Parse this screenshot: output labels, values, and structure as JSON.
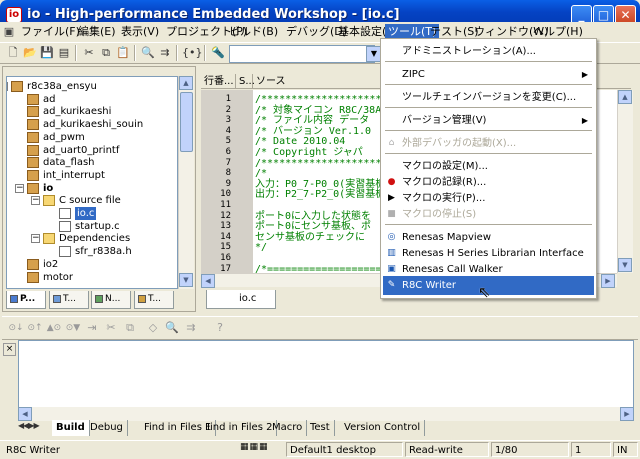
{
  "window": {
    "title": "io - High-performance Embedded Workshop - [io.c]",
    "minimize": "_",
    "maximize": "□",
    "close": "✕"
  },
  "menubar": {
    "items": [
      "ファイル(F)",
      "編集(E)",
      "表示(V)",
      "プロジェクト(P)",
      "ビルド(B)",
      "デバッグ(D)",
      "基本設定(U)",
      "ツール(T)",
      "テスト(S)",
      "ウィンドウ(W)",
      "ヘルプ(H)"
    ],
    "active_index": 7
  },
  "workspace": {
    "tree": [
      {
        "label": "r8c38a_ensyu",
        "depth": 0,
        "type": "project",
        "expander": "−"
      },
      {
        "label": "ad",
        "depth": 1,
        "type": "project"
      },
      {
        "label": "ad_kurikaeshi",
        "depth": 1,
        "type": "project"
      },
      {
        "label": "ad_kurikaeshi_souin",
        "depth": 1,
        "type": "project"
      },
      {
        "label": "ad_pwm",
        "depth": 1,
        "type": "project"
      },
      {
        "label": "ad_uart0_printf",
        "depth": 1,
        "type": "project"
      },
      {
        "label": "data_flash",
        "depth": 1,
        "type": "project"
      },
      {
        "label": "int_interrupt",
        "depth": 1,
        "type": "project"
      },
      {
        "label": "io",
        "depth": 1,
        "type": "project",
        "expander": "−",
        "bold": true
      },
      {
        "label": "C source file",
        "depth": 2,
        "type": "folder",
        "expander": "−"
      },
      {
        "label": "io.c",
        "depth": 3,
        "type": "file",
        "selected": true
      },
      {
        "label": "startup.c",
        "depth": 3,
        "type": "file"
      },
      {
        "label": "Dependencies",
        "depth": 2,
        "type": "folder",
        "expander": "−"
      },
      {
        "label": "sfr_r838a.h",
        "depth": 3,
        "type": "file"
      },
      {
        "label": "io2",
        "depth": 1,
        "type": "project"
      },
      {
        "label": "motor",
        "depth": 1,
        "type": "project"
      }
    ],
    "tabs": [
      "P...",
      "T...",
      "N...",
      "T..."
    ]
  },
  "editor": {
    "header": {
      "line": "行番...",
      "s": "S...",
      "source": "ソース"
    },
    "line_numbers": [
      "1",
      "2",
      "3",
      "4",
      "5",
      "6",
      "7",
      "8",
      "9",
      "10",
      "11",
      "12",
      "13",
      "14",
      "15",
      "16",
      "17"
    ],
    "lines": [
      "/************************************",
      "/* 対象マイコン  R8C/38A",
      "/* ファイル内容    データ",
      "/* バージョン    Ver.1.0",
      "/* Date          2010.04",
      "/* Copyright     ジャパ",
      "/************************************",
      "/*",
      "入力：P0_7-P0_0(実習基板",
      "出力：P2_7-P2_0(実習基板",
      "",
      "ポート0に入力した状態を",
      "ポート0にセンサ基板、ポ",
      "センサ基板のチェックに",
      "*/",
      "",
      "/*==================================="
    ],
    "trailing_text": "ば",
    "tab": "io.c"
  },
  "tools_menu": {
    "items": [
      {
        "label": "アドミニストレーション(A)...",
        "type": "item"
      },
      {
        "type": "sep"
      },
      {
        "label": "ZIPC",
        "type": "item",
        "submenu": true
      },
      {
        "type": "sep"
      },
      {
        "label": "ツールチェインバージョンを変更(C)...",
        "type": "item"
      },
      {
        "type": "sep"
      },
      {
        "label": "バージョン管理(V)",
        "type": "item",
        "submenu": true
      },
      {
        "type": "sep"
      },
      {
        "label": "外部デバッガの起動(X)...",
        "type": "item",
        "disabled": true,
        "icon": "external-debugger-icon"
      },
      {
        "type": "sep"
      },
      {
        "label": "マクロの設定(M)...",
        "type": "item"
      },
      {
        "label": "マクロの記録(R)...",
        "type": "item",
        "icon": "record-icon"
      },
      {
        "label": "マクロの実行(P)...",
        "type": "item",
        "icon": "play-icon"
      },
      {
        "label": "マクロの停止(S)",
        "type": "item",
        "disabled": true,
        "icon": "stop-icon"
      },
      {
        "type": "sep"
      },
      {
        "label": "Renesas Mapview",
        "type": "item",
        "icon": "mapview-icon"
      },
      {
        "label": "Renesas H Series Librarian Interface",
        "type": "item",
        "icon": "librarian-icon"
      },
      {
        "label": "Renesas Call Walker",
        "type": "item",
        "icon": "call-walker-icon"
      },
      {
        "label": "R8C Writer",
        "type": "item",
        "highlighted": true,
        "icon": "r8c-writer-icon"
      }
    ]
  },
  "output": {
    "tabs": [
      "Build",
      "Debug",
      "Find in Files 1",
      "Find in Files 2",
      "Macro",
      "Test",
      "Version Control"
    ],
    "active_tab": 0
  },
  "statusbar": {
    "message": "R8C Writer",
    "session": "Default1 desktop",
    "mode": "Read-write",
    "position": "1/80",
    "column": "1",
    "ins": "IN"
  },
  "colors": {
    "titlebar": "#0543c4",
    "highlight": "#316ac5",
    "code": "#008000",
    "face": "#ece9d8"
  }
}
